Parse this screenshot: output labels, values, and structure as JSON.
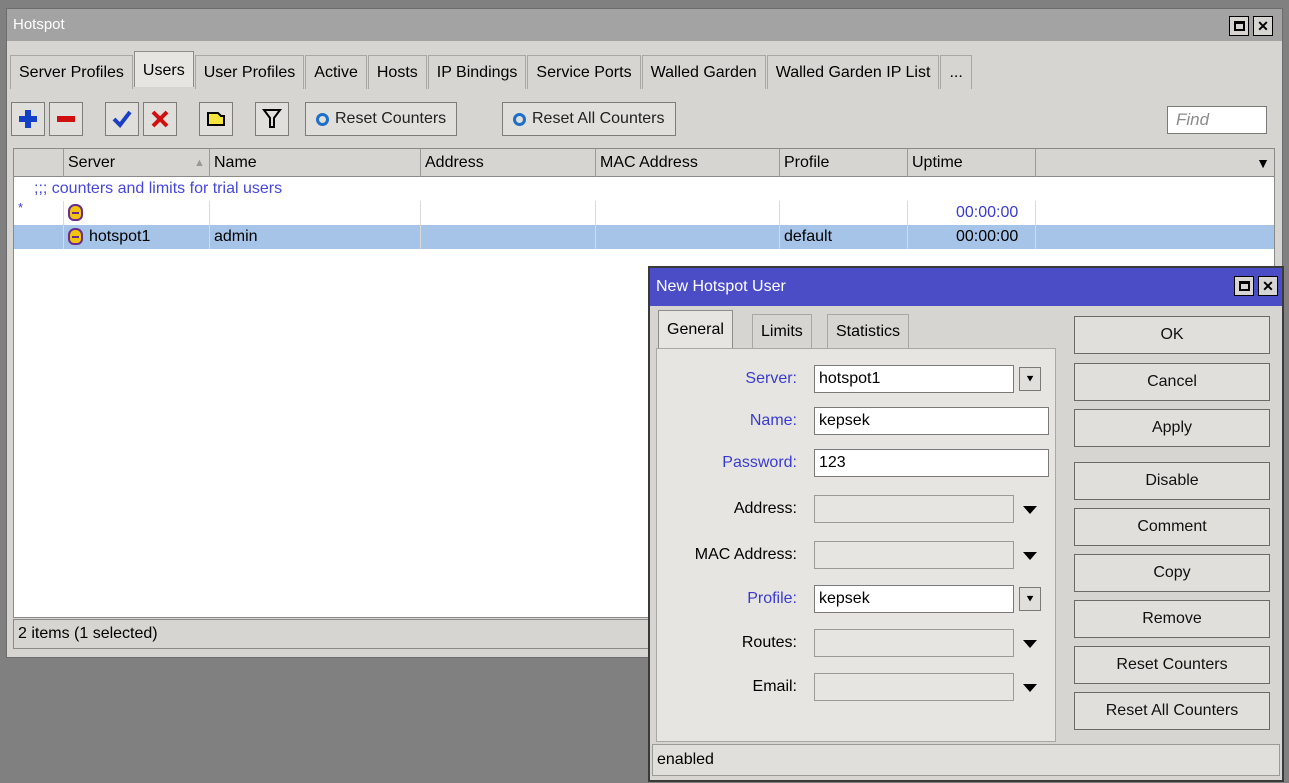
{
  "main_window": {
    "title": "Hotspot",
    "tabs": [
      "Server Profiles",
      "Users",
      "User Profiles",
      "Active",
      "Hosts",
      "IP Bindings",
      "Service Ports",
      "Walled Garden",
      "Walled Garden IP List",
      "..."
    ],
    "active_tab": "Users",
    "toolbar": {
      "reset_counters_label": "Reset Counters",
      "reset_all_counters_label": "Reset All Counters",
      "find_placeholder": "Find"
    },
    "table": {
      "columns": [
        "Server",
        "Name",
        "Address",
        "MAC Address",
        "Profile",
        "Uptime"
      ],
      "sort_column": "Name",
      "comment": ";;; counters and limits for trial users",
      "rows": [
        {
          "marker": "*",
          "server": "",
          "name": "",
          "address": "",
          "mac": "",
          "profile": "",
          "uptime": "00:00:00",
          "selected": false
        },
        {
          "marker": "",
          "server": "hotspot1",
          "name": "admin",
          "address": "",
          "mac": "",
          "profile": "default",
          "uptime": "00:00:00",
          "selected": true
        }
      ]
    },
    "status": "2 items (1 selected)"
  },
  "dialog": {
    "title": "New Hotspot User",
    "tabs": [
      "General",
      "Limits",
      "Statistics"
    ],
    "active_tab": "General",
    "fields": {
      "server": {
        "label": "Server:",
        "value": "hotspot1"
      },
      "name": {
        "label": "Name:",
        "value": "kepsek"
      },
      "password": {
        "label": "Password:",
        "value": "123"
      },
      "address": {
        "label": "Address:",
        "value": ""
      },
      "mac_address": {
        "label": "MAC Address:",
        "value": ""
      },
      "profile": {
        "label": "Profile:",
        "value": "kepsek"
      },
      "routes": {
        "label": "Routes:",
        "value": ""
      },
      "email": {
        "label": "Email:",
        "value": ""
      }
    },
    "buttons": {
      "ok": "OK",
      "cancel": "Cancel",
      "apply": "Apply",
      "disable": "Disable",
      "comment": "Comment",
      "copy": "Copy",
      "remove": "Remove",
      "reset_counters": "Reset Counters",
      "reset_all_counters": "Reset All Counters"
    },
    "status": "enabled"
  },
  "colors": {
    "dialog_title_bg": "#4b4dc6",
    "selected_row": "#a5c4e8",
    "link_blue": "#3b3bcb",
    "window_bg": "#d6d5d2"
  }
}
